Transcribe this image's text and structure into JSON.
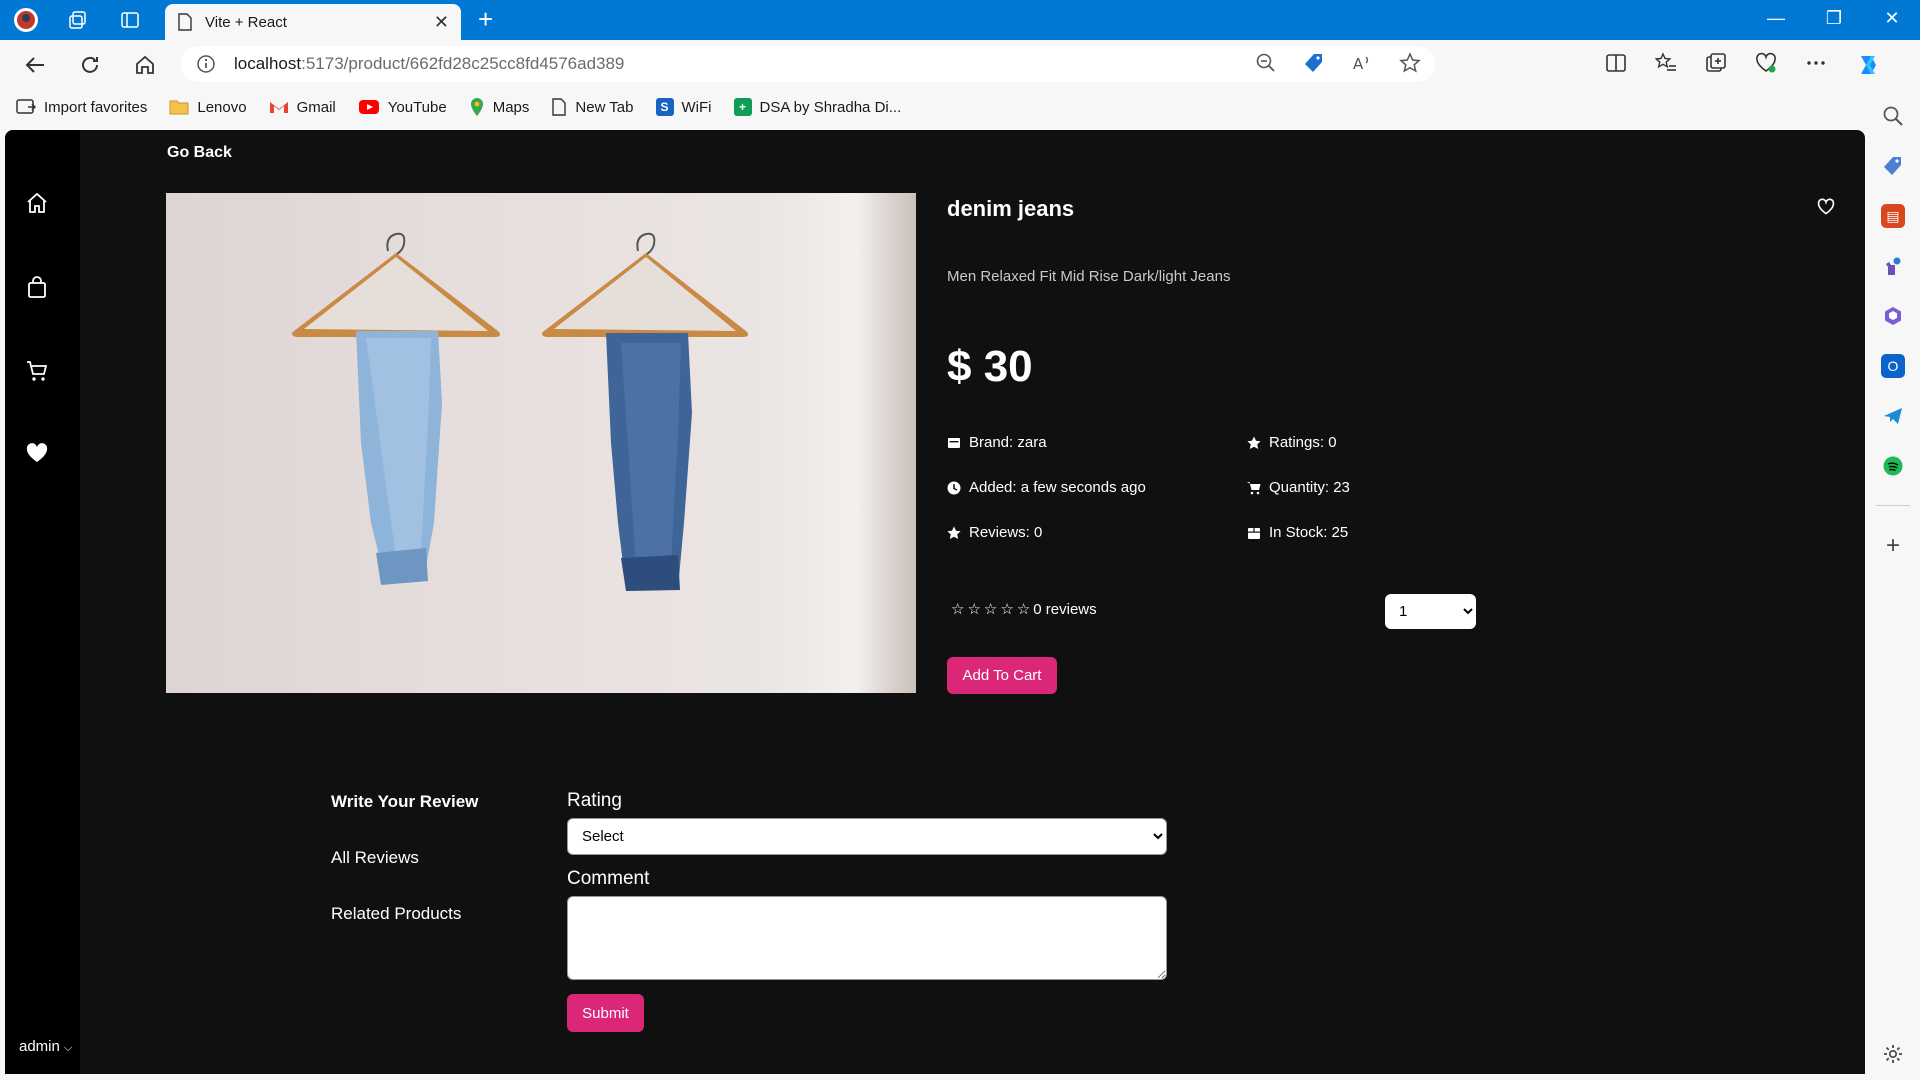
{
  "browser": {
    "tab_title": "Vite + React",
    "url_host": "localhost",
    "url_path": ":5173/product/662fd28c25cc8fd4576ad389",
    "favorites": [
      {
        "label": "Import favorites",
        "icon": "import-icon"
      },
      {
        "label": "Lenovo",
        "icon": "folder-icon"
      },
      {
        "label": "Gmail",
        "icon": "gmail-icon"
      },
      {
        "label": "YouTube",
        "icon": "youtube-icon"
      },
      {
        "label": "Maps",
        "icon": "maps-icon"
      },
      {
        "label": "New Tab",
        "icon": "page-icon"
      },
      {
        "label": "WiFi",
        "icon": "wifi-s-icon"
      },
      {
        "label": "DSA by Shradha Di...",
        "icon": "sheets-icon"
      }
    ]
  },
  "app": {
    "go_back": "Go Back",
    "user_menu": "admin",
    "product": {
      "name": "denim jeans",
      "description": "Men Relaxed Fit Mid Rise Dark/light Jeans",
      "price": "$ 30",
      "brand": "Brand: zara",
      "added": "Added: a few seconds ago",
      "reviews": "Reviews: 0",
      "ratings": "Ratings: 0",
      "quantity": "Quantity: 23",
      "in_stock": "In Stock: 25",
      "rating_value": 0,
      "reviews_text": "0 reviews",
      "qty_selected": "1",
      "add_to_cart": "Add To Cart"
    },
    "review": {
      "tabs": [
        "Write Your Review",
        "All Reviews",
        "Related Products"
      ],
      "rating_label": "Rating",
      "rating_select": "Select",
      "comment_label": "Comment",
      "submit": "Submit"
    }
  },
  "colors": {
    "accent": "#db2777",
    "titlebar": "#0078d4",
    "app_bg": "#101010"
  }
}
